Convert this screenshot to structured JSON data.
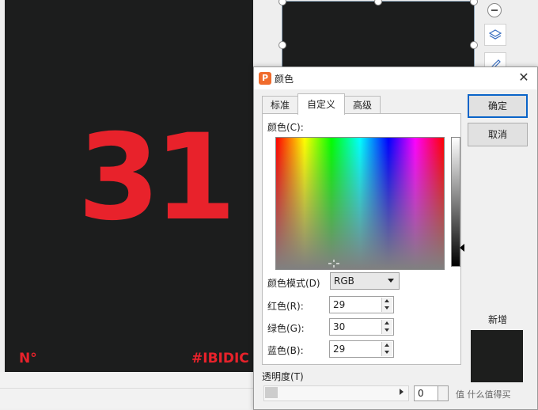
{
  "slide": {
    "number": "31",
    "corner_left": "N°",
    "corner_right": "#IBIDIC"
  },
  "dialog": {
    "title": "颜色",
    "tabs": [
      "标准",
      "自定义",
      "高级"
    ],
    "color_label": "颜色(C):",
    "mode_label": "颜色模式(D)",
    "mode_value": "RGB",
    "red_label": "红色(R):",
    "red_value": "29",
    "green_label": "绿色(G):",
    "green_value": "30",
    "blue_label": "蓝色(B):",
    "blue_value": "29",
    "ok_label": "确定",
    "cancel_label": "取消",
    "new_label": "新增",
    "opacity_label": "透明度(T)",
    "opacity_value": "0",
    "preview_color": "#1d1e1d"
  },
  "colors": {
    "slide_bg": "#1c1d1d",
    "accent_red": "#e8222b"
  },
  "watermark": "值 什么值得买"
}
